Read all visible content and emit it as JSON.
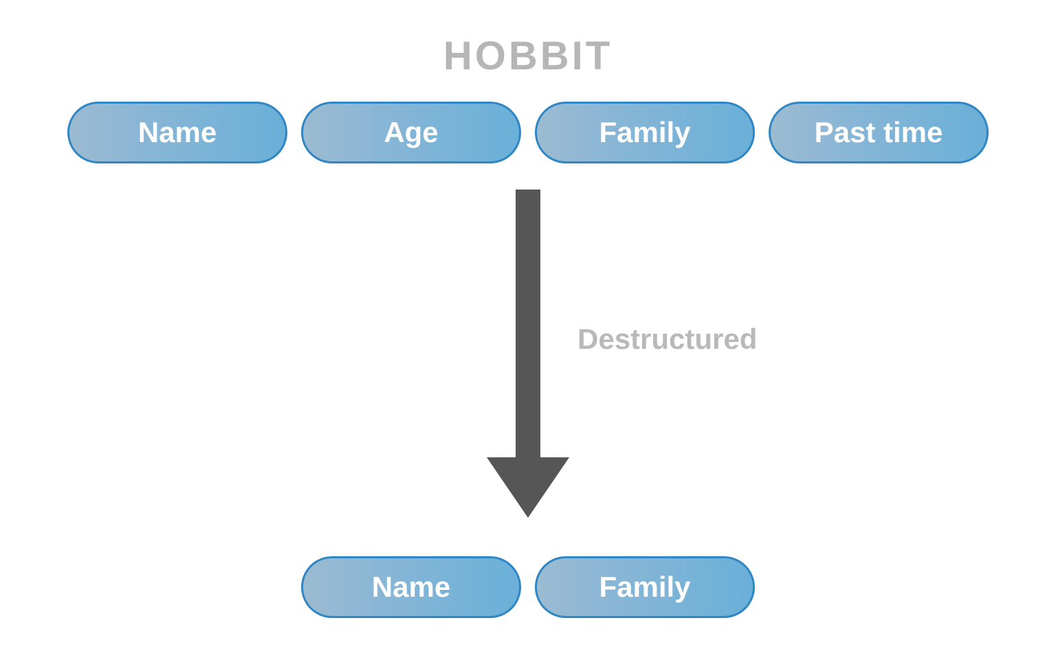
{
  "title": "HOBBIT",
  "source_pills": [
    "Name",
    "Age",
    "Family",
    "Past time"
  ],
  "arrow_label": "Destructured",
  "result_pills": [
    "Name",
    "Family"
  ],
  "colors": {
    "pill_border": "#2f86c4",
    "pill_grad_start": "#9cbbd1",
    "pill_grad_end": "#6ab0d8",
    "pill_text": "#ffffff",
    "arrow": "#565656",
    "muted_text": "#4a4a4a"
  }
}
